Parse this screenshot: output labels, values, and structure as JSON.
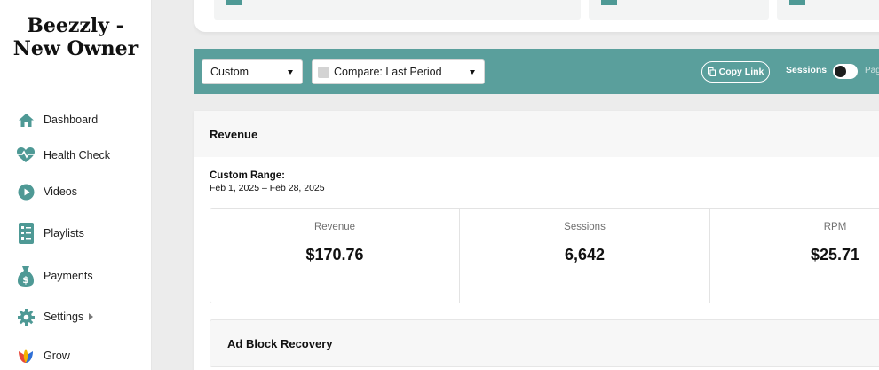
{
  "brand": {
    "line1": "Beezzly -",
    "line2": "New Owner"
  },
  "sidebar": {
    "items": [
      {
        "label": "Dashboard",
        "icon": "home-icon"
      },
      {
        "label": "Health Check",
        "icon": "heartbeat-icon"
      },
      {
        "label": "Videos",
        "icon": "play-circle-icon"
      },
      {
        "label": "Playlists",
        "icon": "list-icon"
      },
      {
        "label": "Payments",
        "icon": "money-bag-icon"
      },
      {
        "label": "Settings",
        "icon": "gear-icon"
      },
      {
        "label": "Grow",
        "icon": "grow-logo-icon"
      }
    ]
  },
  "filters": {
    "range_select": "Custom",
    "compare_select": "Compare: Last Period",
    "copy_link": "Copy Link",
    "sessions_label": "Sessions",
    "page_label": "Pag"
  },
  "revenue": {
    "title": "Revenue",
    "range_title": "Custom Range:",
    "range_value": "Feb 1, 2025 – Feb 28, 2025",
    "stats": [
      {
        "label": "Revenue",
        "value": "$170.76"
      },
      {
        "label": "Sessions",
        "value": "6,642"
      },
      {
        "label": "RPM",
        "value": "$25.71"
      }
    ]
  },
  "adblock": {
    "title": "Ad Block Recovery"
  },
  "colors": {
    "accent": "#5a9f9c",
    "icon": "#4e9995"
  }
}
